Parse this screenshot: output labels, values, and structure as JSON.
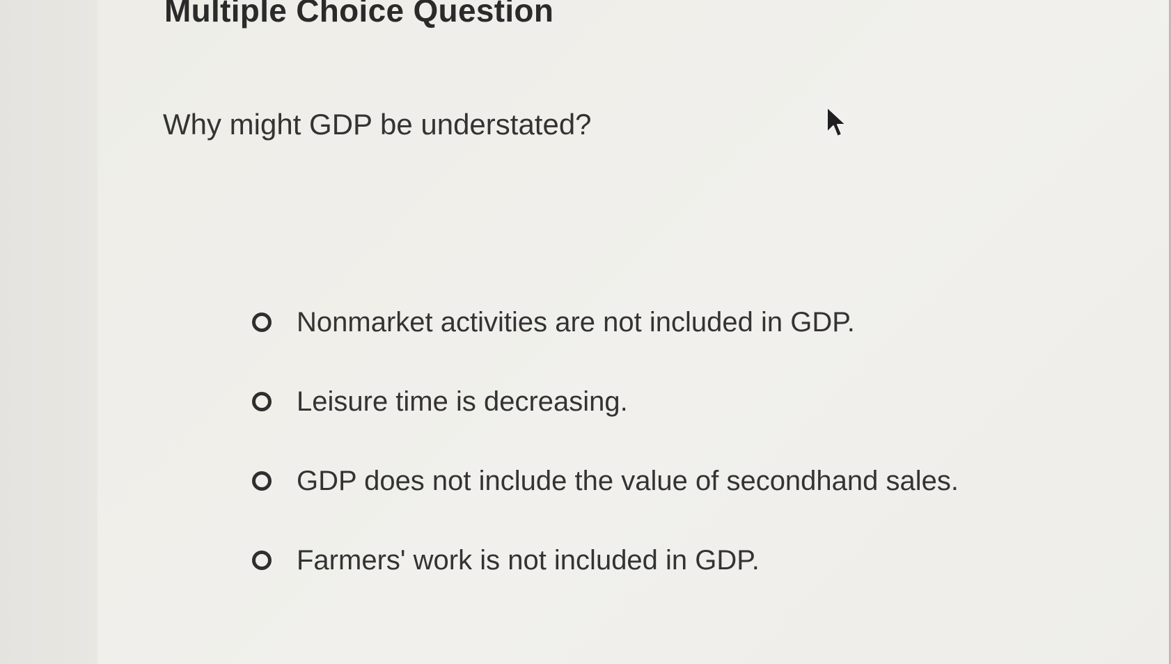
{
  "page": {
    "heading": "Multiple Choice Question",
    "question": "Why might GDP be understated?"
  },
  "choices": [
    {
      "label": "Nonmarket activities are not included in GDP.",
      "selected": false
    },
    {
      "label": "Leisure time is decreasing.",
      "selected": false
    },
    {
      "label": "GDP does not include the value of secondhand sales.",
      "selected": false
    },
    {
      "label": "Farmers' work is not included in GDP.",
      "selected": false
    }
  ],
  "icons": {
    "radio": "radio-unchecked-icon",
    "cursor": "mouse-pointer-icon"
  },
  "colors": {
    "text": "#333333",
    "heading": "#2a2a2a",
    "background": "#eeede8"
  }
}
